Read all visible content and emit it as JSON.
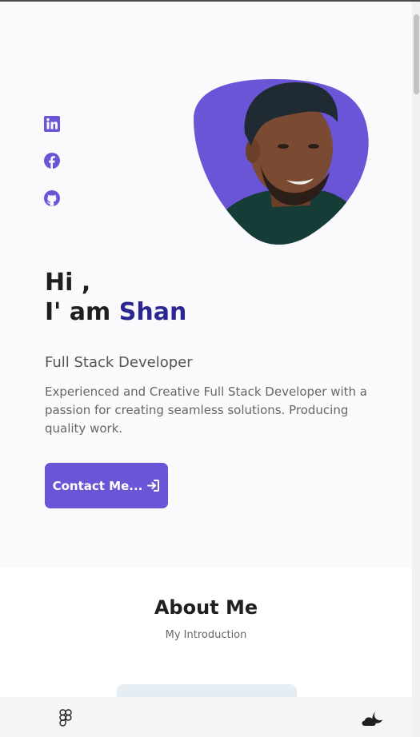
{
  "hero": {
    "greeting_line1": "Hi ,",
    "greeting_prefix": "I' am ",
    "name": "Shan",
    "role": "Full Stack Developer",
    "description": "Experienced and Creative Full Stack Developer with a passion for creating seamless solutions. Producing quality work.",
    "contact_button": "Contact Me..."
  },
  "social": {
    "items": [
      {
        "icon": "linkedin-icon"
      },
      {
        "icon": "facebook-icon"
      },
      {
        "icon": "github-icon"
      }
    ]
  },
  "about": {
    "title": "About Me",
    "subtitle": "My Introduction"
  },
  "bottom_bar": {
    "left_icon": "figma-icon",
    "right_icon": "moon-cloud-icon"
  },
  "colors": {
    "accent": "#6a55d6",
    "name_color": "#2b2792",
    "hero_bg": "#fafafc"
  }
}
